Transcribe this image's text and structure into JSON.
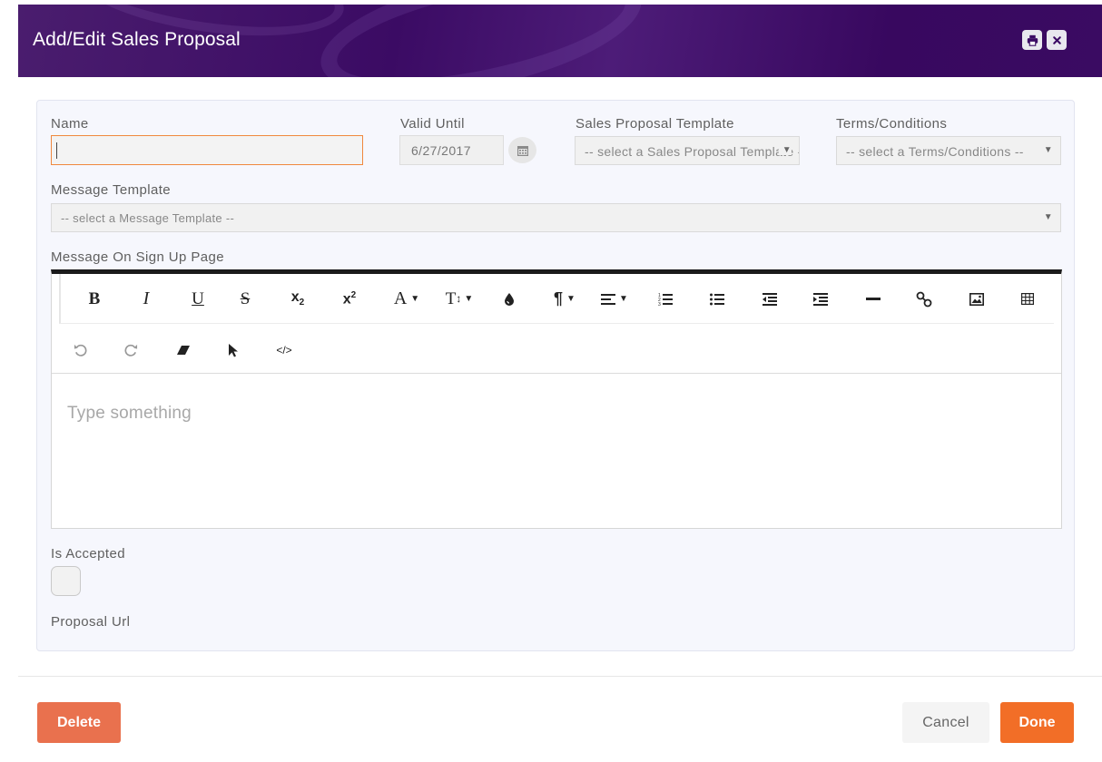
{
  "dialog": {
    "title": "Add/Edit Sales Proposal",
    "print_icon": "print-icon",
    "close_icon": "close-icon"
  },
  "form": {
    "name": {
      "label": "Name",
      "value": ""
    },
    "valid_until": {
      "label": "Valid Until",
      "value": "6/27/2017",
      "icon": "calendar-icon"
    },
    "sales_proposal_template": {
      "label": "Sales Proposal Template",
      "selected": "-- select a Sales Proposal Template --"
    },
    "terms_conditions": {
      "label": "Terms/Conditions",
      "selected": "-- select a Terms/Conditions --"
    },
    "message_template": {
      "label": "Message Template",
      "selected": "-- select a Message Template --"
    },
    "message_on_sign_up_page": {
      "label": "Message On Sign Up Page",
      "placeholder": "Type something"
    },
    "is_accepted": {
      "label": "Is Accepted",
      "checked": false
    },
    "proposal_url": {
      "label": "Proposal Url"
    }
  },
  "editor_toolbar": {
    "row1": [
      "bold",
      "italic",
      "underline",
      "strikethrough",
      "subscript",
      "superscript",
      "font-color",
      "font-size",
      "fill-color",
      "paragraph",
      "align",
      "ordered-list",
      "unordered-list",
      "outdent",
      "indent",
      "horizontal-rule",
      "link",
      "image",
      "table"
    ],
    "row2": [
      "undo",
      "redo",
      "clear-formatting",
      "select-all",
      "html-view"
    ],
    "bold_label": "B",
    "italic_label": "I",
    "underline_label": "U",
    "strike_label": "S",
    "font_label": "A",
    "size_label": "T",
    "paragraph_label": "¶"
  },
  "footer": {
    "delete_label": "Delete",
    "cancel_label": "Cancel",
    "done_label": "Done"
  },
  "colors": {
    "header": "#3b0b64",
    "accent": "#f26e27",
    "delete": "#e9714e"
  }
}
